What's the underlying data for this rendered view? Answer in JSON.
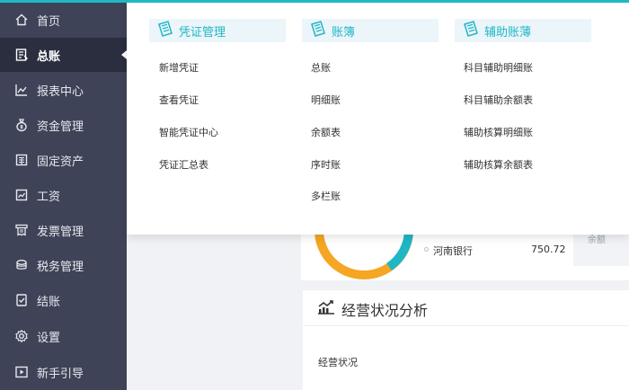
{
  "sidebar": {
    "items": [
      {
        "label": "首页",
        "icon": "home-icon"
      },
      {
        "label": "总账",
        "icon": "ledger-icon"
      },
      {
        "label": "报表中心",
        "icon": "report-chart-icon"
      },
      {
        "label": "资金管理",
        "icon": "money-bag-icon"
      },
      {
        "label": "固定资产",
        "icon": "asset-building-icon"
      },
      {
        "label": "工资",
        "icon": "payroll-chart-icon"
      },
      {
        "label": "发票管理",
        "icon": "invoice-icon"
      },
      {
        "label": "税务管理",
        "icon": "tax-icon"
      },
      {
        "label": "结账",
        "icon": "checkout-icon"
      },
      {
        "label": "设置",
        "icon": "gear-icon"
      },
      {
        "label": "新手引导",
        "icon": "play-guide-icon"
      }
    ],
    "active_index": 1
  },
  "dropdown": {
    "columns": [
      {
        "title": "凭证管理",
        "links": [
          "新增凭证",
          "查看凭证",
          "智能凭证中心",
          "凭证汇总表"
        ]
      },
      {
        "title": "账簿",
        "links": [
          "总账",
          "明细账",
          "余额表",
          "序时账",
          "多栏账"
        ]
      },
      {
        "title": "辅助账薄",
        "links": [
          "科目辅助明细账",
          "科目辅助余额表",
          "辅助核算明细账",
          "辅助核算余额表"
        ]
      }
    ]
  },
  "funds": {
    "legend_label": "河南银行",
    "legend_value": "750.72",
    "side_label": "余额"
  },
  "business": {
    "title": "经营状况分析",
    "subtitle": "经营状况"
  },
  "colors": {
    "sidebar_bg": "#3f4357",
    "sidebar_active": "#2b2e3e",
    "accent": "#1fb7c4",
    "donut_orange": "#f5a623",
    "donut_teal": "#1fb7c4"
  }
}
